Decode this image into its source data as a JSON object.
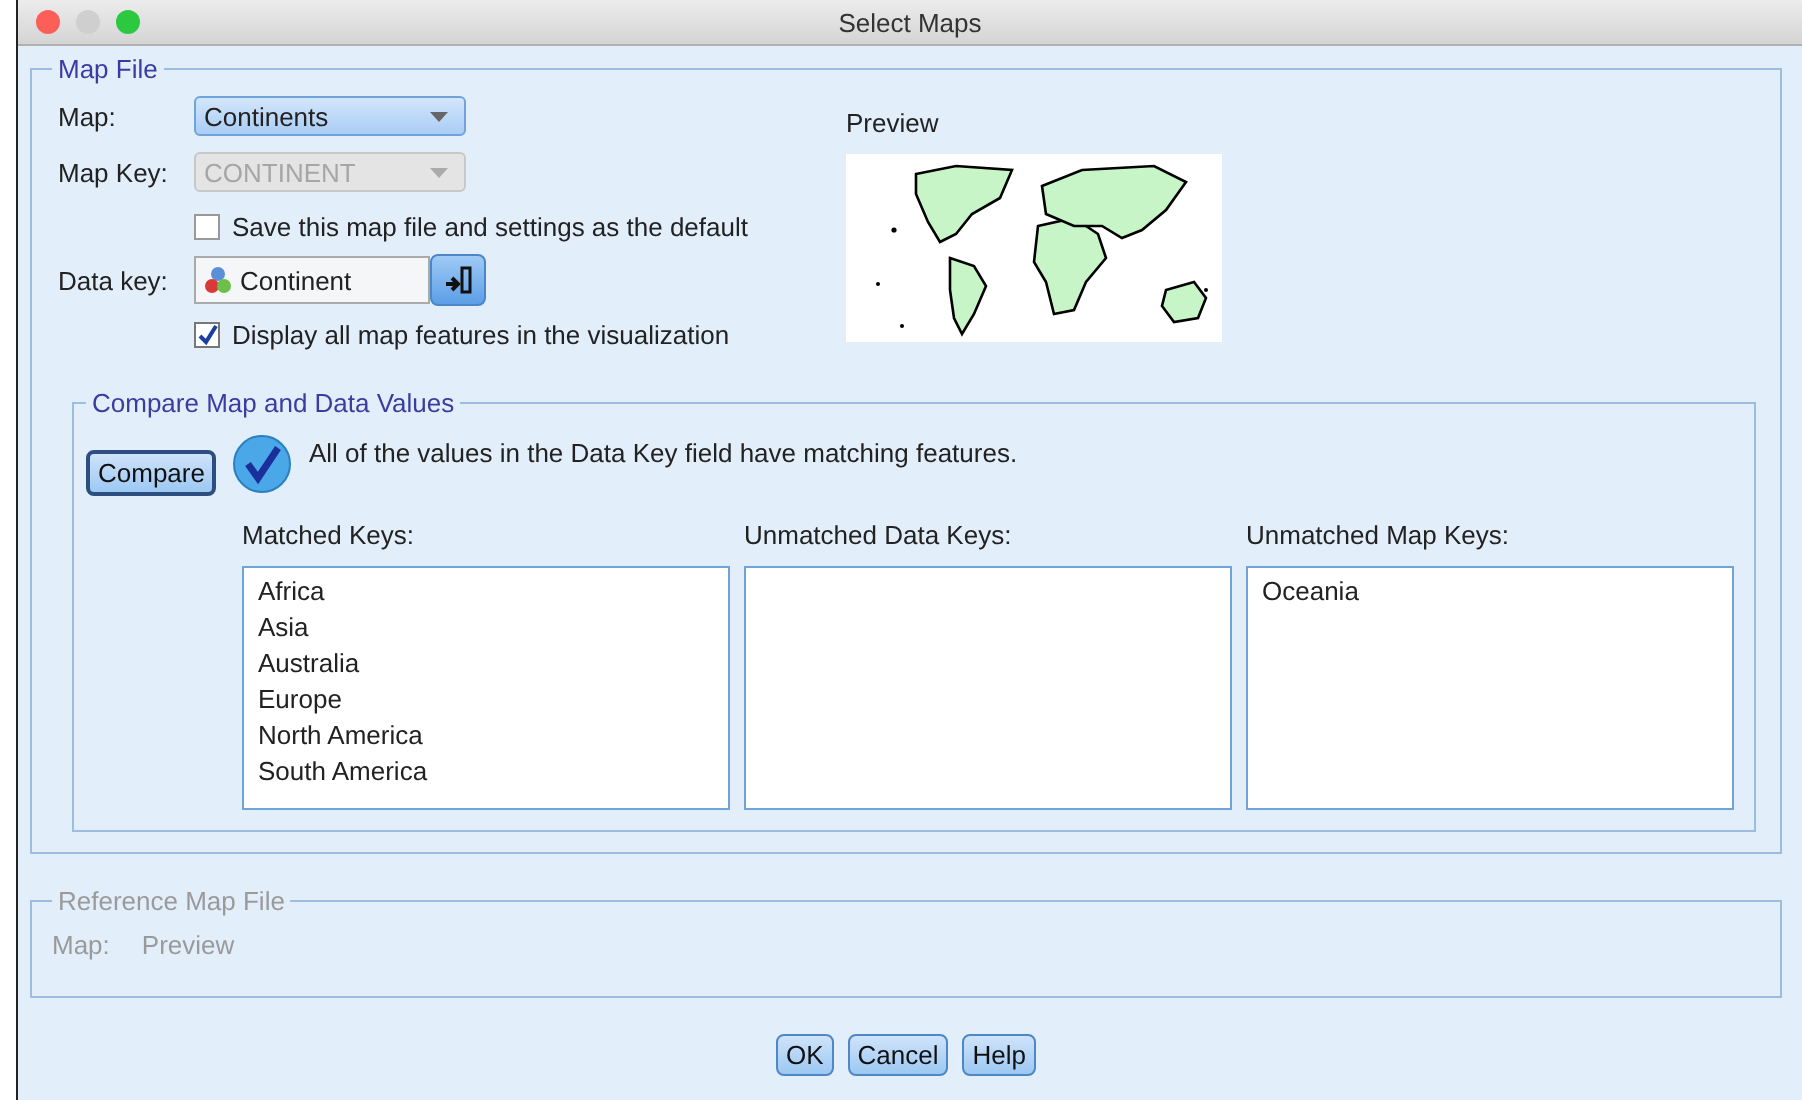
{
  "window": {
    "title": "Select Maps"
  },
  "map_file": {
    "title": "Map File",
    "map": {
      "label": "Map:",
      "value": "Continents",
      "disabled": false
    },
    "map_key": {
      "label": "Map Key:",
      "value": "CONTINENT",
      "disabled": true
    },
    "save_default": {
      "label": "Save this map file and settings as the default",
      "checked": false
    },
    "data_key": {
      "label": "Data key:",
      "value": "Continent"
    },
    "display_all": {
      "label": "Display all map features in the visualization",
      "checked": true
    },
    "preview": {
      "label": "Preview"
    }
  },
  "compare": {
    "title": "Compare Map and Data Values",
    "button": "Compare",
    "message": "All of the values in the Data Key field have matching features.",
    "lists": [
      {
        "title": "Matched Keys:",
        "items": [
          "Africa",
          "Asia",
          "Australia",
          "Europe",
          "North America",
          "South America"
        ]
      },
      {
        "title": "Unmatched Data Keys:"
      },
      {
        "title": "Unmatched Map Keys:",
        "items": [
          "Oceania"
        ]
      }
    ]
  },
  "reference": {
    "title": "Reference Map File",
    "disabled": true,
    "map_label": "Map:",
    "map_value": "Preview"
  },
  "buttons": [
    "OK",
    "Cancel",
    "Help"
  ]
}
